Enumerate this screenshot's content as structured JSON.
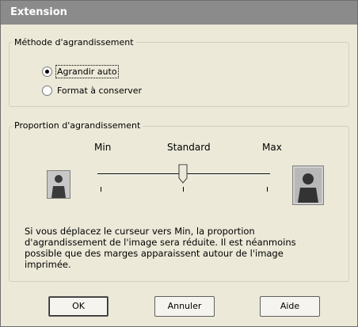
{
  "window": {
    "title": "Extension"
  },
  "method_group": {
    "label": "Méthode d'agrandissement",
    "options": [
      {
        "label": "Agrandir auto",
        "checked": true
      },
      {
        "label": "Format à conserver",
        "checked": false
      }
    ]
  },
  "proportion_group": {
    "label": "Proportion d'agrandissement",
    "scale_labels": {
      "min": "Min",
      "standard": "Standard",
      "max": "Max"
    },
    "slider_position": 0.5,
    "icons": {
      "small": "small-person-icon",
      "large": "large-person-icon"
    }
  },
  "description": "Si vous déplacez le curseur vers Min, la proportion d'agrandissement de l'image sera réduite. Il est néanmoins possible que des marges apparaissent autour de l'image imprimée.",
  "buttons": {
    "ok": "OK",
    "cancel": "Annuler",
    "help": "Aide"
  }
}
